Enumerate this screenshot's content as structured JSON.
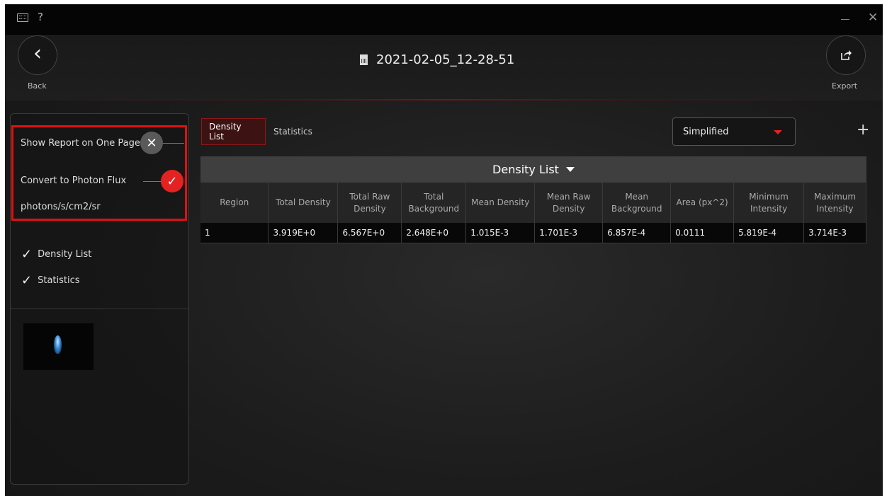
{
  "titlebar": {
    "help_label": "?",
    "keyboard_icon": "keyboard-icon",
    "minimize_icon": "minimize-icon",
    "close_icon": "close-icon",
    "close_glyph": "✕"
  },
  "header": {
    "back_label": "Back",
    "back_glyph": "‹",
    "export_label": "Export",
    "document_title": "2021-02-05_12-28-51"
  },
  "options": {
    "show_report_label": "Show Report on One Page",
    "show_report_enabled": false,
    "show_report_glyph": "✕",
    "convert_label": "Convert to Photon Flux",
    "convert_enabled": true,
    "convert_glyph": "✓",
    "unit_label": "photons/s/cm2/sr"
  },
  "sections": [
    {
      "label": "Density List",
      "checked": true,
      "glyph": "✓"
    },
    {
      "label": "Statistics",
      "checked": true,
      "glyph": "✓"
    }
  ],
  "tabs": [
    {
      "label": "Density List",
      "active": true
    },
    {
      "label": "Statistics",
      "active": false
    }
  ],
  "mode_dropdown": {
    "selected": "Simplified"
  },
  "add_glyph": "+",
  "table": {
    "title": "Density List",
    "columns": [
      "Region",
      "Total Density",
      "Total Raw Density",
      "Total Background",
      "Mean Density",
      "Mean Raw Density",
      "Mean Background",
      "Area (px^2)",
      "Minimum Intensity",
      "Maximum Intensity"
    ],
    "rows": [
      [
        "1",
        "3.919E+0",
        "6.567E+0",
        "2.648E+0",
        "1.015E-3",
        "1.701E-3",
        "6.857E-4",
        "0.0111",
        "5.819E-4",
        "3.714E-3"
      ]
    ]
  },
  "colors": {
    "accent": "#e52222",
    "highlight_border": "#e01010",
    "background": "#1c1c1c"
  }
}
